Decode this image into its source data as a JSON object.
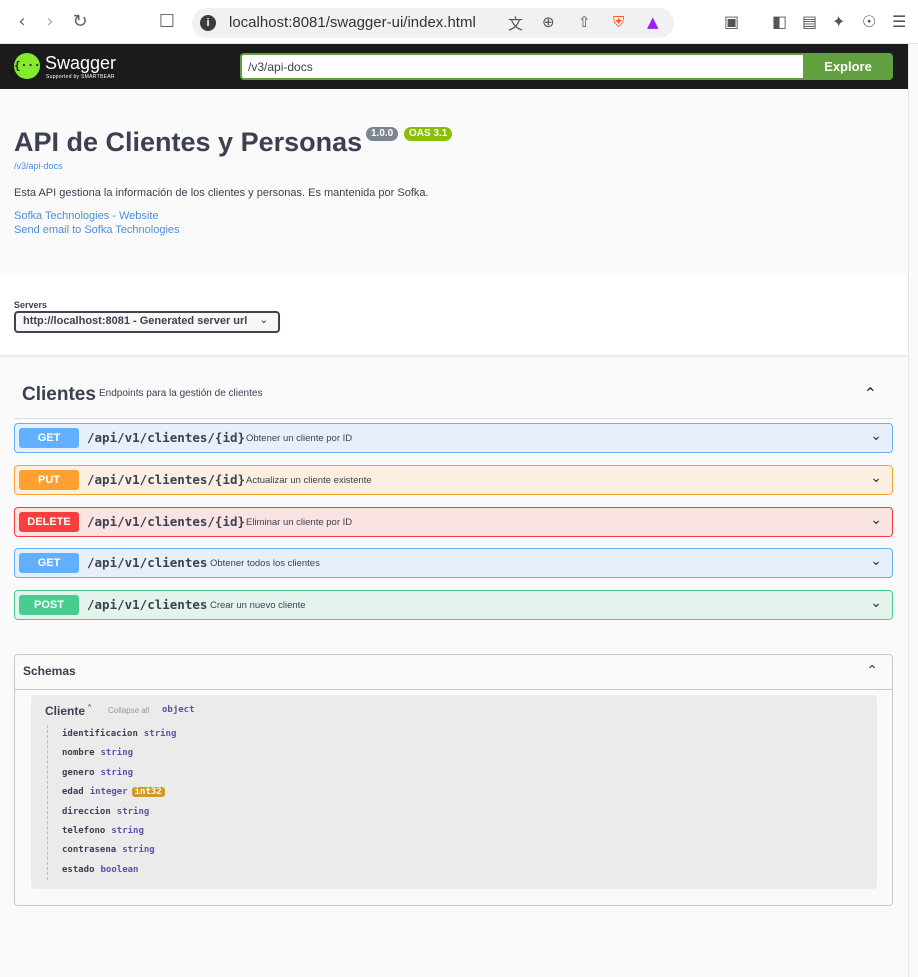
{
  "browser": {
    "url": "localhost:8081/swagger-ui/index.html",
    "back_icon": "chevron-left",
    "forward_icon": "chevron-right",
    "reload_icon": "reload"
  },
  "topbar": {
    "logo_mark": "{···}",
    "logo_text": "Swagger",
    "logo_sub": "Supported by SMARTBEAR",
    "spec_url": "/v3/api-docs",
    "explore_label": "Explore"
  },
  "info": {
    "title": "API de Clientes y Personas",
    "version": "1.0.0",
    "oas": "OAS 3.1",
    "doc_link": "/v3/api-docs",
    "description": "Esta API gestiona la información de los clientes y personas. Es mantenida por Sofka.",
    "links": [
      "Sofka Technologies - Website",
      "Send email to Sofka Technologies"
    ]
  },
  "servers": {
    "label": "Servers",
    "selected": "http://localhost:8081 - Generated server url"
  },
  "tag": {
    "name": "Clientes",
    "description": "Endpoints para la gestión de clientes"
  },
  "operations": [
    {
      "method": "GET",
      "path": "/api/v1/clientes/{id}",
      "summary": "Obtener un cliente por ID"
    },
    {
      "method": "PUT",
      "path": "/api/v1/clientes/{id}",
      "summary": "Actualizar un cliente existente"
    },
    {
      "method": "DELETE",
      "path": "/api/v1/clientes/{id}",
      "summary": "Eliminar un cliente por ID"
    },
    {
      "method": "GET",
      "path": "/api/v1/clientes",
      "summary": "Obtener todos los clientes"
    },
    {
      "method": "POST",
      "path": "/api/v1/clientes",
      "summary": "Crear un nuevo cliente"
    }
  ],
  "schemas": {
    "title": "Schemas",
    "model": {
      "name": "Cliente",
      "collapse_all": "Collapse all",
      "type": "object",
      "properties": [
        {
          "name": "identificacion",
          "type": "string",
          "format": ""
        },
        {
          "name": "nombre",
          "type": "string",
          "format": ""
        },
        {
          "name": "genero",
          "type": "string",
          "format": ""
        },
        {
          "name": "edad",
          "type": "integer",
          "format": "int32"
        },
        {
          "name": "direccion",
          "type": "string",
          "format": ""
        },
        {
          "name": "telefono",
          "type": "string",
          "format": ""
        },
        {
          "name": "contrasena",
          "type": "string",
          "format": ""
        },
        {
          "name": "estado",
          "type": "boolean",
          "format": ""
        }
      ]
    }
  },
  "colors": {
    "get": "#61affe",
    "put": "#fca130",
    "delete": "#f93e3e",
    "post": "#49cc90",
    "explore": "#62a03f"
  }
}
